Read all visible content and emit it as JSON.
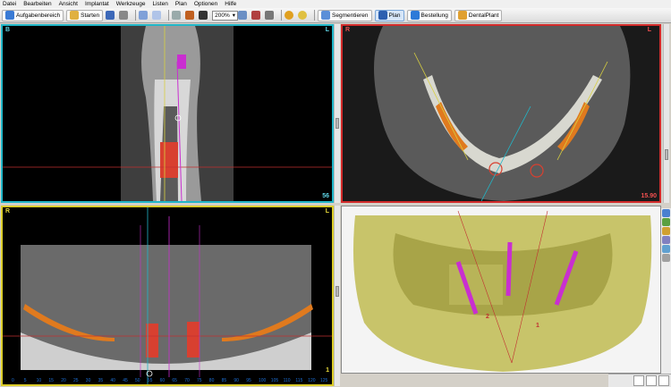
{
  "menu": [
    "Datei",
    "Bearbeiten",
    "Ansicht",
    "Implantat",
    "Werkzeuge",
    "Listen",
    "Plan",
    "Optionen",
    "Hilfe"
  ],
  "toolbar": {
    "aufgabenbereich": "Aufgabenbereich",
    "starten": "Starten",
    "zoom": "200%",
    "segmentieren": "Segmentieren",
    "plan": "Plan",
    "bestellung": "Bestellung",
    "dentalplant": "DentalPlant"
  },
  "views": {
    "sagittal": {
      "label": "B",
      "corner": "L",
      "slice": "56"
    },
    "axial": {
      "label": "R",
      "corner": "L",
      "slice": "15.90"
    },
    "panoramic": {
      "label": "R",
      "corner": "L",
      "slice": "1"
    }
  },
  "ruler_ticks": [
    "0",
    "5",
    "10",
    "15",
    "20",
    "25",
    "30",
    "35",
    "40",
    "45",
    "50",
    "55",
    "60",
    "65",
    "70",
    "75",
    "80",
    "85",
    "90",
    "95",
    "100",
    "105",
    "110",
    "115",
    "120",
    "125"
  ],
  "implant_labels": [
    "2",
    "1"
  ],
  "colors": {
    "sagittal_border": "#21b6c8",
    "axial_border": "#d22a2a",
    "panoramic_border": "#dccd2a",
    "bone": "#c8c46a",
    "implant": "#c92fd0"
  }
}
